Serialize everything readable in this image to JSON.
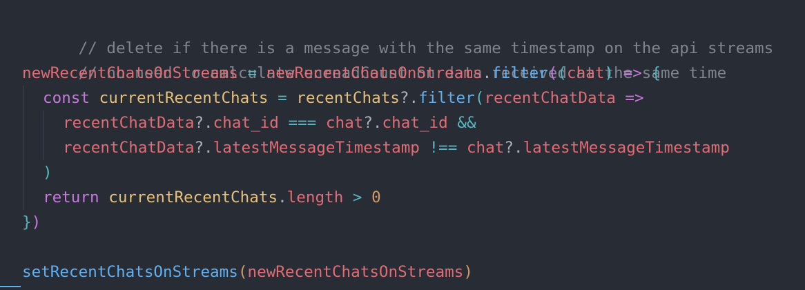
{
  "code": {
    "line1": {
      "text": "// delete if there is a message with the same timestamp on the api streams"
    },
    "line2": {
      "text": "// no need to calculate unreadCount on data received at the same time"
    },
    "line3": {
      "var": "newRecentChatsOnStreams",
      "eq": " = ",
      "obj": "newRecentChatsOnStreams",
      "dot": ".",
      "method": "filter",
      "open": "(",
      "paren_open": "(",
      "param": "chat",
      "paren_close": ")",
      "arrow": " => ",
      "brace": "{"
    },
    "line4": {
      "kw": "const",
      "name": " currentRecentChats",
      "eq": " = ",
      "obj": "recentChats",
      "opt": "?.",
      "method": "filter",
      "open": "(",
      "param": "recentChatData",
      "arrow": " =>"
    },
    "line5": {
      "obj": "recentChatData",
      "opt": "?.",
      "prop": "chat_id",
      "op": " === ",
      "obj2": "chat",
      "opt2": "?.",
      "prop2": "chat_id",
      "and": " &&"
    },
    "line6": {
      "obj": "recentChatData",
      "opt": "?.",
      "prop": "latestMessageTimestamp",
      "op": " !== ",
      "obj2": "chat",
      "opt2": "?.",
      "prop2": "latestMessageTimestamp"
    },
    "line7": {
      "close": ")"
    },
    "line8": {
      "kw": "return",
      "name": " currentRecentChats",
      "dot": ".",
      "prop": "length",
      "op": " > ",
      "num": "0"
    },
    "line9": {
      "brace": "}",
      "close": ")"
    },
    "line10": {
      "text": ""
    },
    "line11": {
      "fn": "setRecentChatsOnStreams",
      "open": "(",
      "arg": "newRecentChatsOnStreams",
      "close": ")"
    }
  },
  "colors": {
    "background": "#282c34",
    "comment": "#7f848e",
    "variable": "#e06c75",
    "function": "#61afef",
    "keyword": "#c678dd",
    "class": "#e5c07b",
    "operator": "#56b6c2",
    "number": "#d19a66"
  }
}
